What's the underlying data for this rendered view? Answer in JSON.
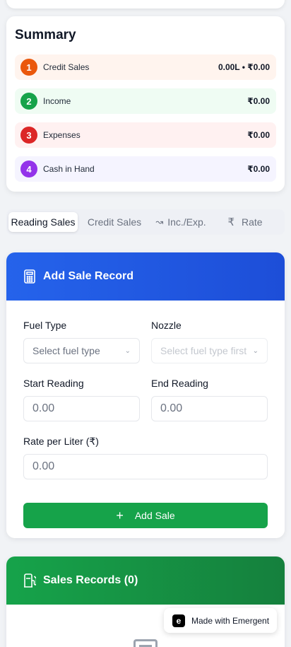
{
  "summary": {
    "title": "Summary",
    "rows": [
      {
        "num": "1",
        "label": "Credit Sales",
        "value": "0.00L • ₹0.00",
        "bg": "#fff4ee",
        "badge": "#ea580c"
      },
      {
        "num": "2",
        "label": "Income",
        "value": "₹0.00",
        "bg": "#effcf3",
        "badge": "#16a34a"
      },
      {
        "num": "3",
        "label": "Expenses",
        "value": "₹0.00",
        "bg": "#fff1f1",
        "badge": "#dc2626"
      },
      {
        "num": "4",
        "label": "Cash in Hand",
        "value": "₹0.00",
        "bg": "#f5f4ff",
        "badge": "#9333ea"
      }
    ]
  },
  "tabs": [
    {
      "label": "Reading Sales",
      "icon": "",
      "active": true
    },
    {
      "label": "Credit Sales",
      "icon": "",
      "active": false
    },
    {
      "label": "Inc./Exp.",
      "icon": "trending-icon",
      "active": false
    },
    {
      "label": "Rate",
      "icon": "rupee-icon",
      "active": false
    }
  ],
  "add_sale": {
    "title": "Add Sale Record",
    "fuel_type_label": "Fuel Type",
    "fuel_type_placeholder": "Select fuel type",
    "nozzle_label": "Nozzle",
    "nozzle_placeholder": "Select fuel type first",
    "start_reading_label": "Start Reading",
    "start_reading_value": "0.00",
    "end_reading_label": "End Reading",
    "end_reading_value": "0.00",
    "rate_label": "Rate per Liter (₹)",
    "rate_value": "0.00",
    "button_label": "Add Sale"
  },
  "sales_records": {
    "title": "Sales Records (0)"
  },
  "badge": {
    "text": "Made with Emergent"
  },
  "colors": {
    "primary_blue": "#2563eb",
    "primary_green": "#16a34a"
  }
}
